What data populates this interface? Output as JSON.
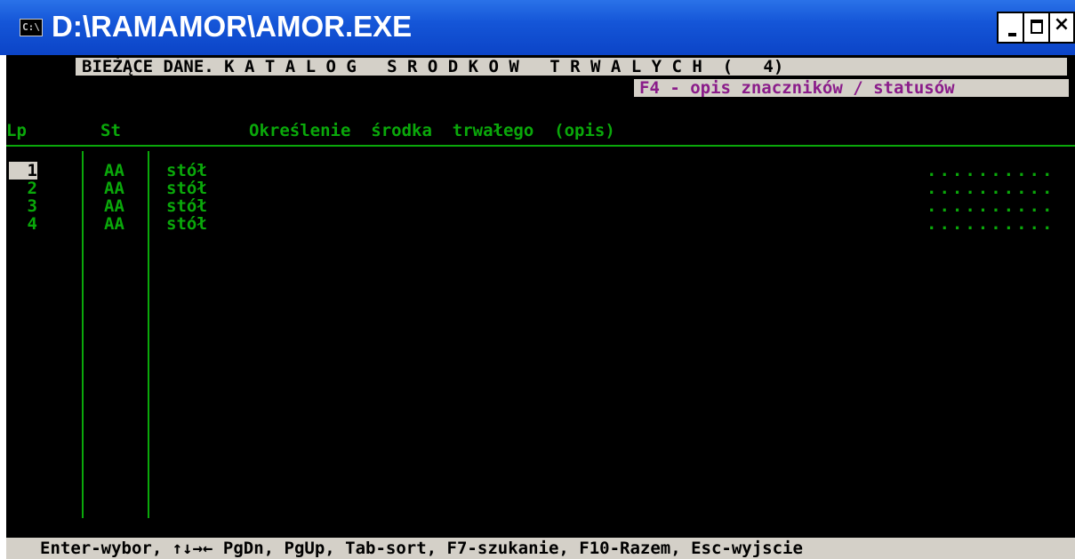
{
  "window": {
    "title": "D:\\RAMAMOR\\AMOR.EXE",
    "icon": "console-icon",
    "icon_label": "C:\\"
  },
  "header": {
    "title": "BIEŻĄCE DANE. K A T A L O G   S R O D K O W   T R W A L Y C H  (   4)",
    "hint": "F4 - opis znaczników / statusów"
  },
  "columns": {
    "lp": "Lp",
    "st": "St",
    "desc": "Określenie  środka  trwałego  (opis)"
  },
  "rows": [
    {
      "lp": "1",
      "st": "AA",
      "desc": "stół",
      "dots": "..........",
      "selected": true
    },
    {
      "lp": "2",
      "st": "AA",
      "desc": "stół",
      "dots": ".........."
    },
    {
      "lp": "3",
      "st": "AA",
      "desc": "stół",
      "dots": ".........."
    },
    {
      "lp": "4",
      "st": "AA",
      "desc": "stół",
      "dots": ".........."
    }
  ],
  "status_bar": "Enter-wybor, ↑↓→← PgDn, PgUp, Tab-sort, F7-szukanie, F10-Razem, Esc-wyjscie",
  "colors": {
    "titlebar": "#0b44c7",
    "console_bg": "#000000",
    "text_green": "#0aa80a",
    "hint_magenta": "#8a1c8a",
    "bar_gray": "#d4d0c8"
  }
}
